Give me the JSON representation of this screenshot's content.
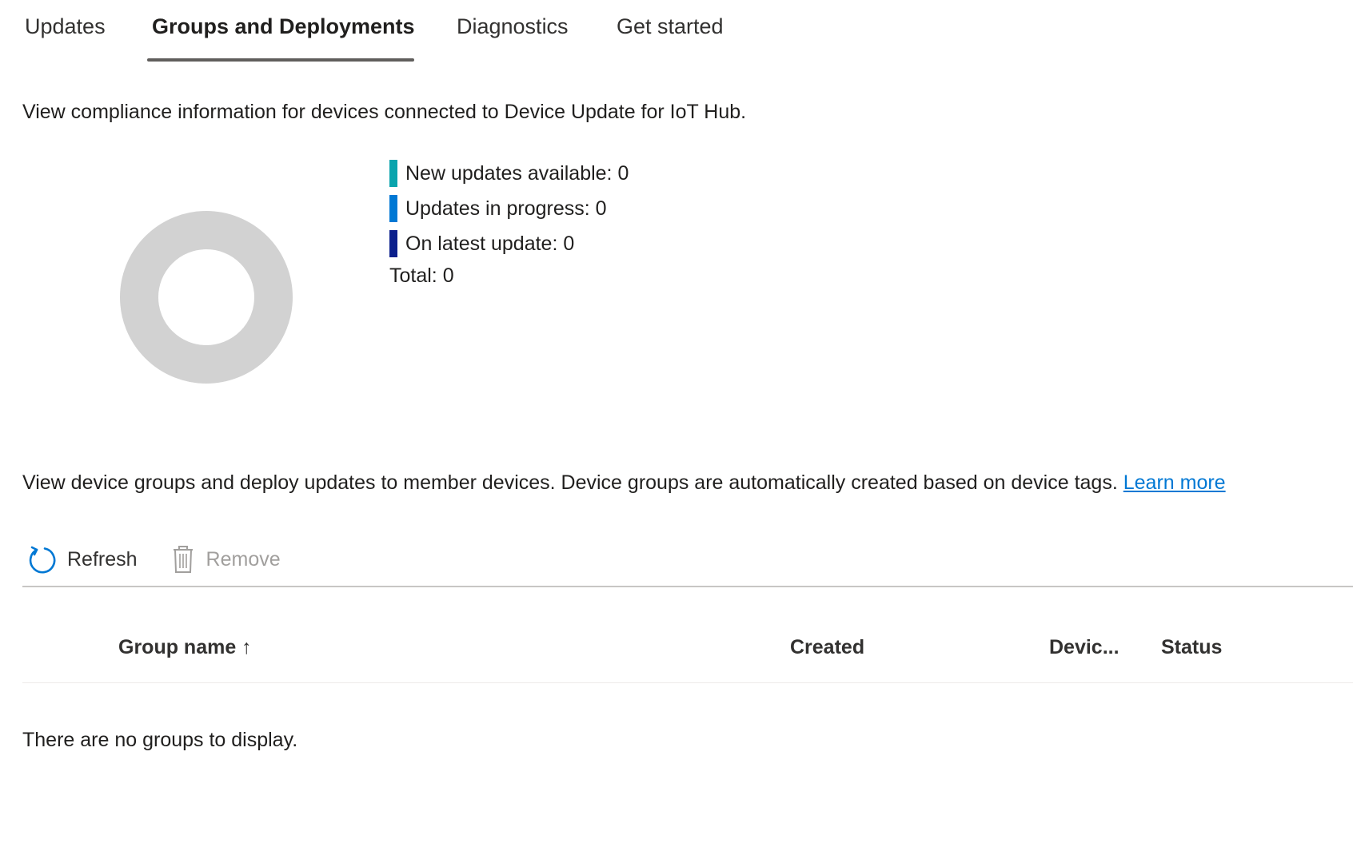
{
  "tabs": [
    {
      "label": "Updates",
      "active": false
    },
    {
      "label": "Groups and Deployments",
      "active": true
    },
    {
      "label": "Diagnostics",
      "active": false
    },
    {
      "label": "Get started",
      "active": false
    }
  ],
  "compliance": {
    "description": "View compliance information for devices connected to Device Update for IoT Hub.",
    "legend": [
      {
        "label": "New updates available: 0",
        "color": "#0aa4ad"
      },
      {
        "label": "Updates in progress: 0",
        "color": "#0078d4"
      },
      {
        "label": "On latest update: 0",
        "color": "#0b1f8c"
      }
    ],
    "total_label": "Total: 0",
    "donut_empty_color": "#d2d2d2"
  },
  "groups": {
    "description": "View device groups and deploy updates to member devices. Device groups are automatically created based on device tags.",
    "learn_more": "Learn more"
  },
  "toolbar": {
    "refresh_label": "Refresh",
    "refresh_icon": "refresh-icon",
    "remove_label": "Remove",
    "remove_icon": "trash-icon",
    "remove_disabled": true
  },
  "table": {
    "columns": [
      {
        "label": "Group name ↑"
      },
      {
        "label": "Created"
      },
      {
        "label": "Devic..."
      },
      {
        "label": "Status"
      }
    ],
    "empty_message": "There are no groups to display."
  }
}
